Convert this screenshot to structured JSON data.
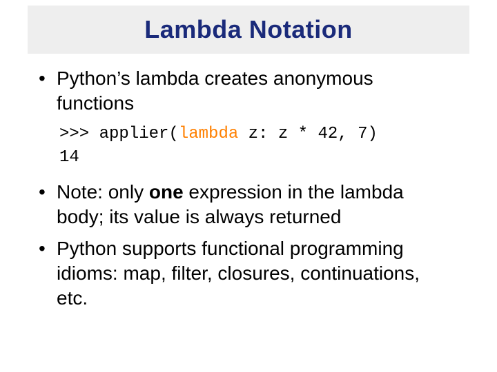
{
  "title": "Lambda Notation",
  "bullets": {
    "b1": "Python’s lambda creates anonymous functions",
    "b2_pre": "Note: only ",
    "b2_bold": "one",
    "b2_post": " expression in the lambda body; its value is always returned",
    "b3": "Python supports functional programming idioms: map, filter, closures, continuations, etc."
  },
  "code": {
    "line1_pre": ">>> applier(",
    "line1_kw": "lambda",
    "line1_post": " z: z * 42, 7)",
    "line2": "14"
  },
  "chart_data": {
    "type": "table",
    "title": "Slide bullet content",
    "rows": [
      "Python’s lambda creates anonymous functions",
      ">>> applier(lambda z: z * 42, 7)  →  14",
      "Note: only one expression in the lambda body; its value is always returned",
      "Python supports functional programming idioms: map, filter, closures, continuations, etc."
    ]
  }
}
